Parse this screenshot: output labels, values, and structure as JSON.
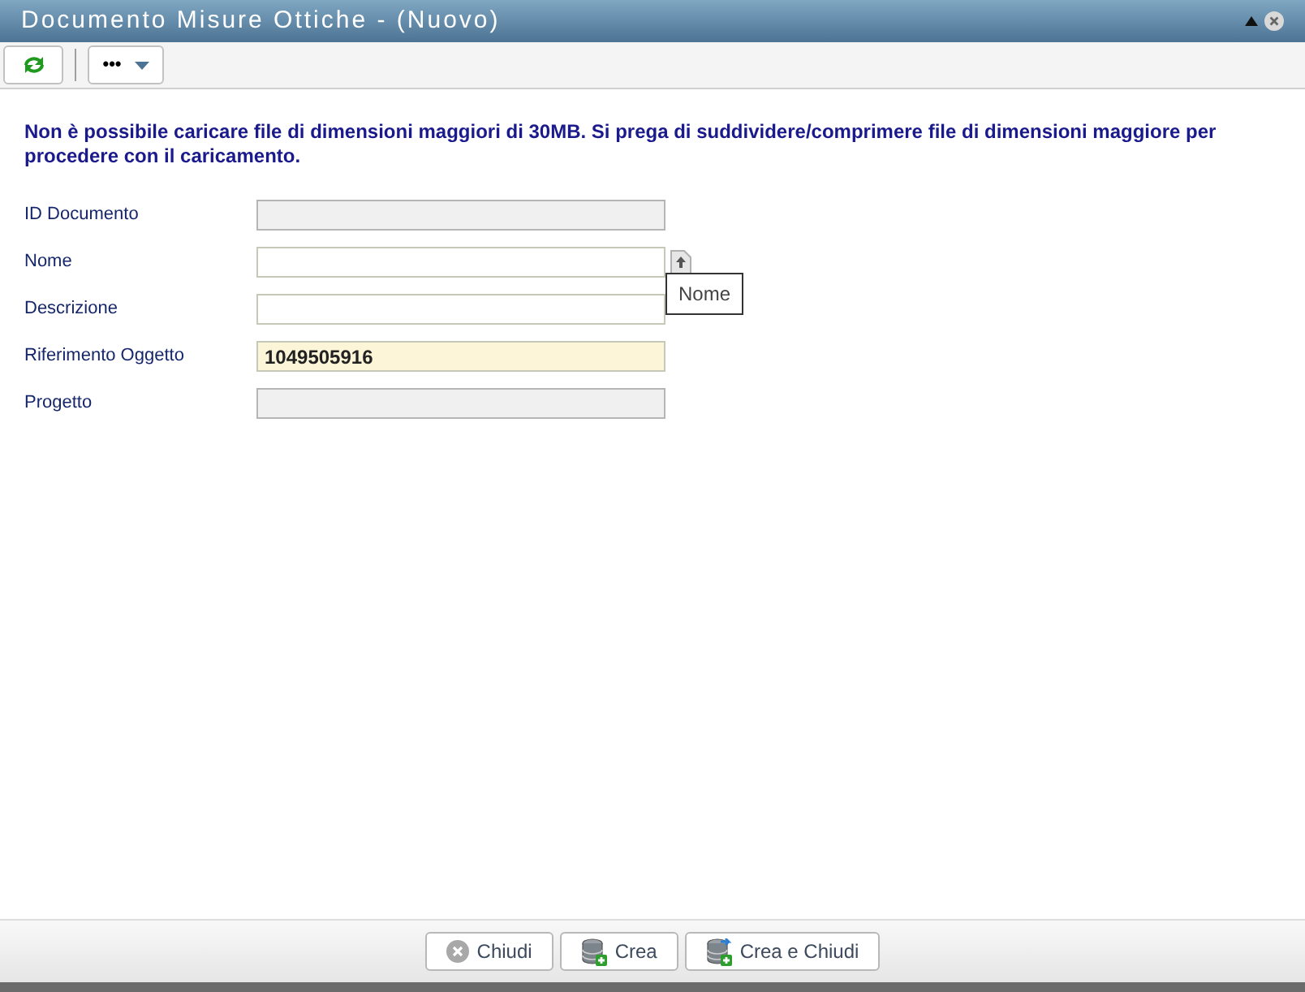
{
  "window": {
    "title": "Documento Misure Ottiche - (Nuovo)"
  },
  "message": "Non è possibile caricare file di dimensioni maggiori di 30MB. Si prega di suddividere/comprimere file di dimensioni maggiore per procedere con il caricamento.",
  "fields": [
    {
      "label": "ID Documento",
      "kind": "disabled"
    },
    {
      "label": "Nome",
      "kind": "upload"
    },
    {
      "label": "Descrizione",
      "kind": "text"
    },
    {
      "label": "Riferimento Oggetto",
      "kind": "highlighted",
      "value": "1049505916"
    },
    {
      "label": "Progetto",
      "kind": "disabled"
    }
  ],
  "tooltip": "Nome",
  "toolbar": {
    "more": "•••"
  },
  "buttons": [
    {
      "label": "Chiudi",
      "kind": "close"
    },
    {
      "label": "Crea",
      "kind": "create"
    },
    {
      "label": "Crea e Chiudi",
      "kind": "create-close"
    }
  ]
}
